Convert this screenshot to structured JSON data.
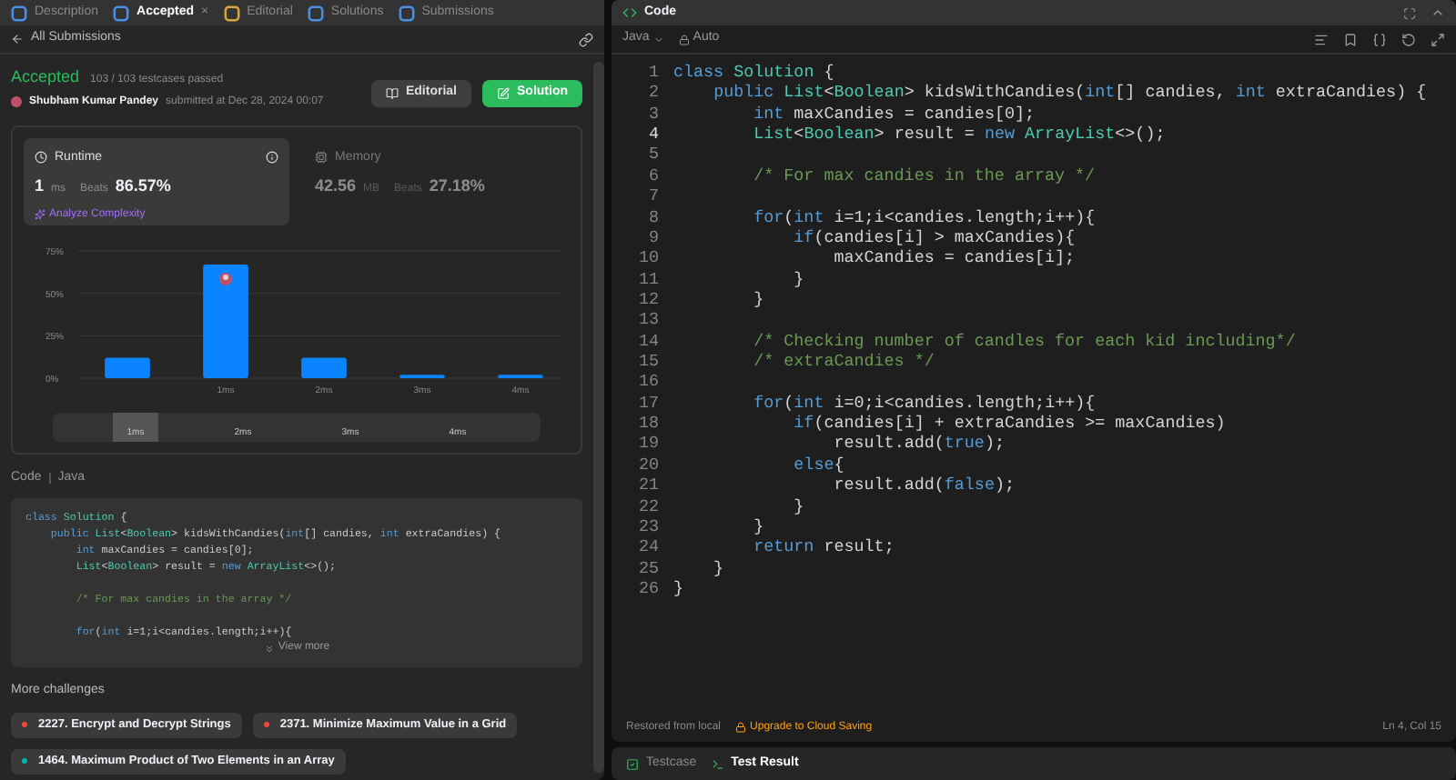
{
  "left_tabs": [
    {
      "label": "Description",
      "selected": false
    },
    {
      "label": "Accepted",
      "selected": true,
      "close": "×"
    },
    {
      "label": "Editorial",
      "selected": false
    },
    {
      "label": "Solutions",
      "selected": false
    },
    {
      "label": "Submissions",
      "selected": false
    }
  ],
  "back_link": "All Submissions",
  "result": {
    "status": "Accepted",
    "testcases": "103 / 103 testcases passed",
    "user": "Shubham Kumar Pandey",
    "submitted": "submitted at Dec 28, 2024 00:07"
  },
  "buttons": [
    {
      "label": "Editorial",
      "kind": "secondary"
    },
    {
      "label": "Solution",
      "kind": "primary"
    }
  ],
  "runtime": {
    "title": "Runtime",
    "value": "1",
    "unit": "ms",
    "beats_label": "Beats",
    "beats": "86.57%",
    "link": "Analyze Complexity",
    "selected": true
  },
  "memory": {
    "title": "Memory",
    "value": "42.56",
    "unit": "MB",
    "beats_label": "Beats",
    "beats": "27.18%",
    "selected": false
  },
  "chart": {
    "chart_data": {
      "type": "bar",
      "categories": [
        null,
        "1ms",
        "2ms",
        "3ms",
        "4ms"
      ],
      "values": [
        12,
        67,
        12,
        2,
        2
      ],
      "ylim": [
        0,
        75
      ],
      "yticks": [
        {
          "value": 0,
          "label": "0%"
        },
        {
          "value": 25,
          "label": "25%"
        },
        {
          "value": 50,
          "label": "50%"
        },
        {
          "value": 75,
          "label": "75%"
        }
      ]
    },
    "brush_labels": [
      "1ms",
      "2ms",
      "3ms",
      "4ms"
    ]
  },
  "code_label": "Code",
  "code_lang": "Java",
  "preview_lines": [
    {
      "kind": "code",
      "text": "class Solution {"
    },
    {
      "kind": "code",
      "text": "    public List<Boolean> kidsWithCandies(int[] candies, int extraCandies) {"
    },
    {
      "kind": "code",
      "text": "        int maxCandies = candies[0];"
    },
    {
      "kind": "code",
      "text": "        List<Boolean> result = new ArrayList<>();"
    },
    {
      "kind": "blank"
    },
    {
      "kind": "code",
      "text": "        /* For max candies in the array */"
    },
    {
      "kind": "blank"
    },
    {
      "kind": "code",
      "text": "        for(int i=1;i<candies.length;i++){"
    }
  ],
  "view_more": "View more",
  "more_title": "More challenges",
  "challenges": [
    {
      "title": "2227. Encrypt and Decrypt Strings",
      "color": "#ef4743"
    },
    {
      "title": "2371. Minimize Maximum Value in a Grid",
      "color": "#ef4743"
    },
    {
      "title": "1464. Maximum Product of Two Elements in an Array",
      "color": "#00b8a3"
    }
  ],
  "editor": {
    "title": "Code",
    "language": "Java",
    "mode": "Auto",
    "lines": [
      {
        "n": "1",
        "text": "class Solution {",
        "current": false
      },
      {
        "n": "2",
        "text": "    public List<Boolean> kidsWithCandies(int[] candies, int extraCandies) {",
        "current": false
      },
      {
        "n": "3",
        "text": "        int maxCandies = candies[0];",
        "current": false
      },
      {
        "n": "4",
        "text": "        List<Boolean> result = new ArrayList<>();",
        "current": true
      },
      {
        "n": "5",
        "current": false
      },
      {
        "n": "6",
        "text": "        /* For max candies in the array */",
        "current": false
      },
      {
        "n": "7",
        "current": false
      },
      {
        "n": "8",
        "text": "        for(int i=1;i<candies.length;i++){",
        "current": false
      },
      {
        "n": "9",
        "text": "            if(candies[i] > maxCandies){",
        "current": false
      },
      {
        "n": "10",
        "text": "                maxCandies = candies[i];",
        "current": false
      },
      {
        "n": "11",
        "text": "            }",
        "current": false
      },
      {
        "n": "12",
        "text": "        }",
        "current": false
      },
      {
        "n": "13",
        "current": false
      },
      {
        "n": "14",
        "text": "        /* Checking number of candles for each kid including*/",
        "current": false
      },
      {
        "n": "15",
        "text": "        /* extraCandies */",
        "current": false
      },
      {
        "n": "16",
        "current": false
      },
      {
        "n": "17",
        "text": "        for(int i=0;i<candies.length;i++){",
        "current": false
      },
      {
        "n": "18",
        "text": "            if(candies[i] + extraCandies >= maxCandies)",
        "current": false
      },
      {
        "n": "19",
        "text": "                result.add(true);",
        "current": false
      },
      {
        "n": "20",
        "text": "            else{",
        "current": false
      },
      {
        "n": "21",
        "text": "                result.add(false);",
        "current": false
      },
      {
        "n": "22",
        "text": "            }",
        "current": false
      },
      {
        "n": "23",
        "text": "        }",
        "current": false
      },
      {
        "n": "24",
        "text": "        return result;",
        "current": false
      },
      {
        "n": "25",
        "text": "    }",
        "current": false
      },
      {
        "n": "26",
        "text": "}",
        "current": false
      }
    ],
    "restored": "Restored from local",
    "upgrade": "Upgrade to Cloud Saving",
    "cursor": "Ln 4, Col 15"
  },
  "bottom_tabs": [
    {
      "label": "Testcase",
      "selected": false
    },
    {
      "label": "Test Result",
      "selected": true
    }
  ]
}
